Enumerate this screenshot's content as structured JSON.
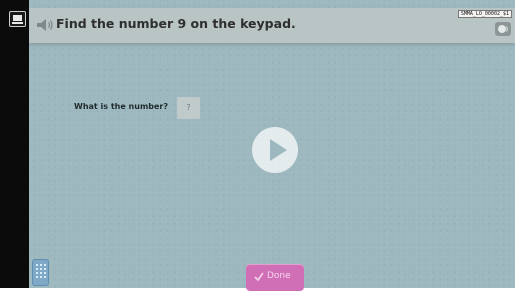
{
  "sidebar": {
    "menu_icon": "menu-icon"
  },
  "header": {
    "title": "Find the number 9 on the keypad.",
    "code": "SMMA_LO_00002_$1",
    "speaker_icon": "speaker-icon",
    "audio_icon": "audio-icon"
  },
  "question": {
    "label": "What is the number?",
    "placeholder": "?"
  },
  "player": {
    "play_icon": "play-icon"
  },
  "footer": {
    "keypad_icon": "keypad-icon",
    "done_label": "Done"
  },
  "colors": {
    "stage": "#9db8bf",
    "header": "#b9c4c4",
    "done_button": "#d16fb6",
    "keypad": "#7ea8c6"
  }
}
